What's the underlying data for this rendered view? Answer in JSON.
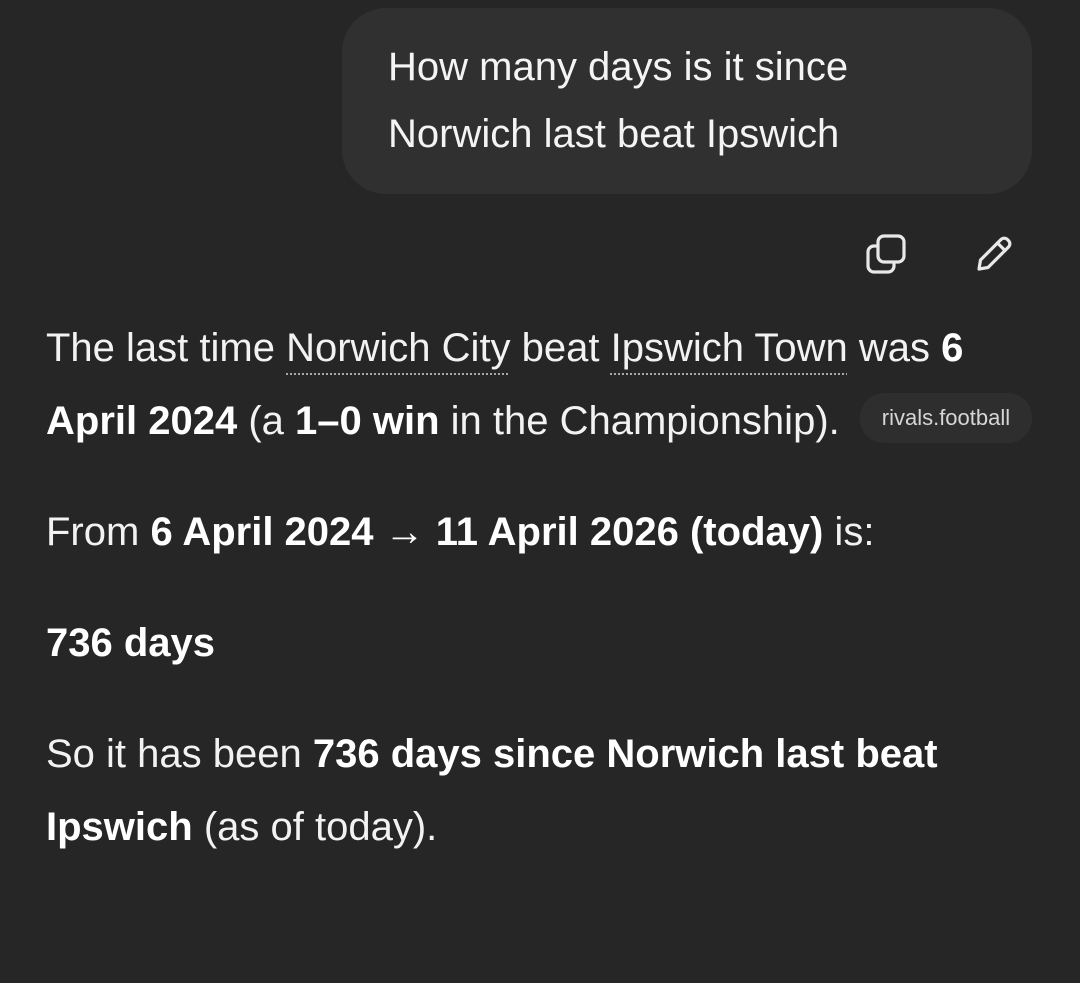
{
  "user_message": {
    "line1": "How many days is it since",
    "line2": "Norwich last beat Ipswich"
  },
  "message_actions": {
    "copy_icon": "copy-icon",
    "edit_icon": "pencil-icon"
  },
  "answer": {
    "p1": {
      "t1": "The last time ",
      "entity1": "Norwich City",
      "t2": " beat ",
      "entity2": "Ipswich Town",
      "t3": " was ",
      "b1": "6 April 2024",
      "t4": " (a ",
      "b2": "1–0 win",
      "t5": " in the Championship).",
      "source": "rivals.football"
    },
    "p2": {
      "t1": "From ",
      "b1": "6 April 2024 → 11 April 2026 (today)",
      "t2": " is:"
    },
    "p3": {
      "b1": "736 days"
    },
    "p4": {
      "t1": "So it has been ",
      "b1": "736 days since Norwich last beat Ipswich",
      "t2": " (as of today)."
    }
  }
}
